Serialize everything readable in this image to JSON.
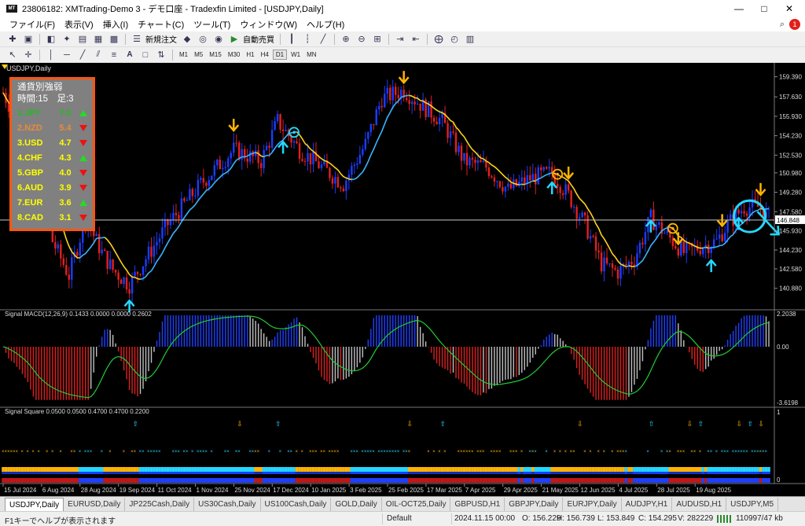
{
  "window": {
    "title": "23806182: XMTrading-Demo 3 - デモ口座 - Tradexfin Limited - [USDJPY,Daily]"
  },
  "menu": [
    "ファイル(F)",
    "表示(V)",
    "挿入(I)",
    "チャート(C)",
    "ツール(T)",
    "ウィンドウ(W)",
    "ヘルプ(H)"
  ],
  "menu_right": {
    "notifications": "1"
  },
  "toolbar": {
    "new_order": "新規注文",
    "auto_trade": "自動売買"
  },
  "timeframes": [
    "M1",
    "M5",
    "M15",
    "M30",
    "H1",
    "H4",
    "D1",
    "W1",
    "MN"
  ],
  "active_timeframe": "D1",
  "chart": {
    "symbol_label": "USDJPY,Daily",
    "current_price": "146.848",
    "price_ticks": [
      "159.390",
      "157.630",
      "155.930",
      "154.230",
      "152.530",
      "150.980",
      "149.280",
      "147.580",
      "145.930",
      "144.230",
      "142.580",
      "140.880"
    ],
    "date_ticks": [
      "15 Jul 2024",
      "6 Aug 2024",
      "28 Aug 2024",
      "19 Sep 2024",
      "11 Oct 2024",
      "1 Nov 2024",
      "25 Nov 2024",
      "17 Dec 2024",
      "10 Jan 2025",
      "3 Feb 2025",
      "25 Feb 2025",
      "17 Mar 2025",
      "7 Apr 2025",
      "29 Apr 2025",
      "21 May 2025",
      "12 Jun 2025",
      "4 Jul 2025",
      "28 Jul 2025",
      "19 Aug 2025"
    ],
    "colors": {
      "bull": "#1a3cff",
      "bear": "#e02020",
      "ma_up": "#3ab4ff",
      "ma_down": "#ffd21a",
      "signal_up": "#25d8ff",
      "signal_down": "#ffb400",
      "background": "#000000"
    }
  },
  "macd": {
    "label": "Signal MACD(12,26,9) 0.1433 0.0000 0.0000 0.2602",
    "ticks": [
      "2.2038",
      "0.00",
      "-3.6198"
    ]
  },
  "square": {
    "label": "Signal Square 0.0500 0.0500 0.4700 0.4700 0.2200",
    "ticks": [
      "1",
      "0"
    ]
  },
  "strength_panel": {
    "title": "通貨別強弱",
    "subtitle": "時間:15　足:3",
    "rows": [
      {
        "label": "1.JPY",
        "value": "7.0",
        "trend": "up",
        "color": "#22bb22"
      },
      {
        "label": "2.NZD",
        "value": "5.4",
        "trend": "down",
        "color": "#e88a3a"
      },
      {
        "label": "3.USD",
        "value": "4.7",
        "trend": "down",
        "color": "#ffff00"
      },
      {
        "label": "4.CHF",
        "value": "4.3",
        "trend": "up",
        "color": "#ffff00"
      },
      {
        "label": "5.GBP",
        "value": "4.0",
        "trend": "down",
        "color": "#ffff00"
      },
      {
        "label": "6.AUD",
        "value": "3.9",
        "trend": "down",
        "color": "#ffff00"
      },
      {
        "label": "7.EUR",
        "value": "3.6",
        "trend": "up",
        "color": "#ffff00"
      },
      {
        "label": "8.CAD",
        "value": "3.1",
        "trend": "down",
        "color": "#ffff00"
      }
    ]
  },
  "tabs": [
    "USDJPY,Daily",
    "EURUSD,Daily",
    "JP225Cash,Daily",
    "US30Cash,Daily",
    "US100Cash,Daily",
    "GOLD,Daily",
    "OIL-OCT25,Daily",
    "GBPUSD,H1",
    "GBPJPY,Daily",
    "EURJPY,Daily",
    "AUDJPY,H1",
    "AUDUSD,H1",
    "USDJPY,M5"
  ],
  "active_tab": 0,
  "status": {
    "help": "F1キーでヘルプが表示されます",
    "profile": "Default",
    "datetime": "2024.11.15 00:00",
    "open": "O: 156.229",
    "high": "H: 156.739",
    "low": "L: 153.849",
    "close": "C: 154.295",
    "volume": "V: 282229",
    "traffic": "110997/47 kb"
  }
}
